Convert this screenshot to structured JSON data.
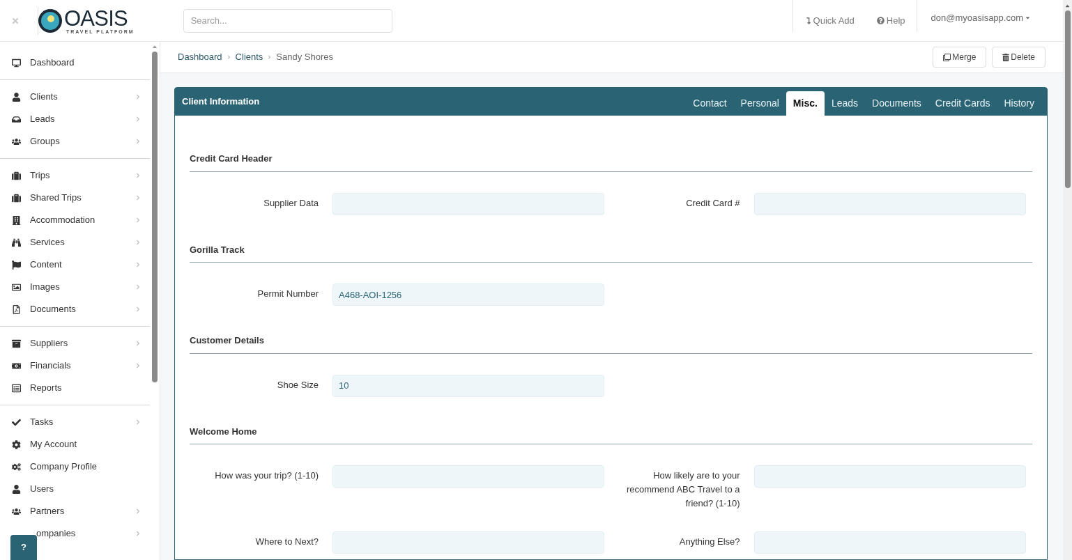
{
  "header": {
    "logo": {
      "name": "OASIS",
      "tagline": "TRAVEL PLATFORM"
    },
    "search": {
      "placeholder": "Search..."
    },
    "quick_add": "Quick Add",
    "help": "Help",
    "user": "don@myoasisapp.com"
  },
  "sidebar": {
    "groups": [
      [
        {
          "label": "Dashboard",
          "submenu": false
        }
      ],
      [
        {
          "label": "Clients",
          "submenu": true
        },
        {
          "label": "Leads",
          "submenu": true
        },
        {
          "label": "Groups",
          "submenu": true
        }
      ],
      [
        {
          "label": "Trips",
          "submenu": true
        },
        {
          "label": "Shared Trips",
          "submenu": true
        },
        {
          "label": "Accommodation",
          "submenu": true
        },
        {
          "label": "Services",
          "submenu": true
        },
        {
          "label": "Content",
          "submenu": true
        },
        {
          "label": "Images",
          "submenu": true
        },
        {
          "label": "Documents",
          "submenu": true
        }
      ],
      [
        {
          "label": "Suppliers",
          "submenu": true
        },
        {
          "label": "Financials",
          "submenu": true
        },
        {
          "label": "Reports",
          "submenu": false
        }
      ],
      [
        {
          "label": "Tasks",
          "submenu": true
        },
        {
          "label": "My Account",
          "submenu": false
        },
        {
          "label": "Company Profile",
          "submenu": false
        },
        {
          "label": "Users",
          "submenu": false
        },
        {
          "label": "Partners",
          "submenu": true
        },
        {
          "label": "ompanies",
          "submenu": true,
          "covered": true
        }
      ]
    ],
    "help_button": "?"
  },
  "breadcrumb": [
    "Dashboard",
    "Clients",
    "Sandy Shores"
  ],
  "actions": [
    "Merge",
    "Delete"
  ],
  "panel": {
    "title": "Client Information",
    "tabs": [
      {
        "label": "Contact",
        "selected": false
      },
      {
        "label": "Personal",
        "selected": false
      },
      {
        "label": "Misc.",
        "selected": true
      },
      {
        "label": "Leads",
        "selected": false
      },
      {
        "label": "Documents",
        "selected": false
      },
      {
        "label": "Credit Cards",
        "selected": false
      },
      {
        "label": "History",
        "selected": false
      }
    ],
    "sections": [
      {
        "title": "Credit Card Header",
        "rows": [
          [
            {
              "label": "Supplier Data"
            },
            {
              "label": "Credit Card #"
            }
          ]
        ]
      },
      {
        "title": "Gorilla Track",
        "rows": [
          [
            {
              "label": "Permit Number",
              "value": "A468-AOI-1256"
            }
          ]
        ]
      },
      {
        "title": "Customer Details",
        "rows": [
          [
            {
              "label": "Shoe Size",
              "value": "10"
            }
          ]
        ]
      },
      {
        "title": "Welcome Home",
        "rows": [
          [
            {
              "label": "How was your trip? (1-10)"
            },
            {
              "label": "How likely are to your recommend ABC Travel to a friend? (1-10)"
            }
          ],
          [
            {
              "label": "Where to Next?"
            },
            {
              "label": "Anything Else?"
            }
          ]
        ]
      }
    ]
  }
}
